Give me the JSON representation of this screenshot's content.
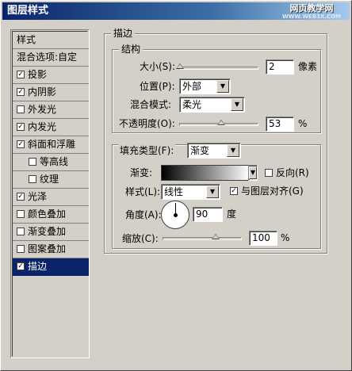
{
  "window": {
    "title": "图层样式",
    "watermark_line1": "网页教学网",
    "watermark_line2": "WWW.WEB3X.COM"
  },
  "left_list": {
    "header": "样式",
    "blend_options": "混合选项:自定",
    "items": [
      {
        "label": "投影",
        "checked": true,
        "indent": false
      },
      {
        "label": "内阴影",
        "checked": true,
        "indent": false
      },
      {
        "label": "外发光",
        "checked": false,
        "indent": false
      },
      {
        "label": "内发光",
        "checked": true,
        "indent": false
      },
      {
        "label": "斜面和浮雕",
        "checked": true,
        "indent": false
      },
      {
        "label": "等高线",
        "checked": false,
        "indent": true
      },
      {
        "label": "纹理",
        "checked": false,
        "indent": true
      },
      {
        "label": "光泽",
        "checked": true,
        "indent": false
      },
      {
        "label": "颜色叠加",
        "checked": false,
        "indent": false
      },
      {
        "label": "渐变叠加",
        "checked": false,
        "indent": false
      },
      {
        "label": "图案叠加",
        "checked": false,
        "indent": false
      },
      {
        "label": "描边",
        "checked": true,
        "indent": false,
        "selected": true
      }
    ]
  },
  "stroke": {
    "group_title": "描边",
    "structure_title": "结构",
    "size_label": "大小(S):",
    "size_value": "2",
    "size_unit": "像素",
    "size_level_percent": 2,
    "position_label": "位置(P):",
    "position_value": "外部",
    "blend_mode_label": "混合模式:",
    "blend_mode_value": "柔光",
    "opacity_label": "不透明度(O):",
    "opacity_value": "53",
    "opacity_unit": "%",
    "opacity_level_percent": 53
  },
  "fill": {
    "fill_type_label": "填充类型(F):",
    "fill_type_value": "渐变",
    "gradient_label": "渐变:",
    "reverse_label": "反向(R)",
    "reverse_checked": false,
    "style_label": "样式(L):",
    "style_value": "线性",
    "align_label": "与图层对齐(G)",
    "align_checked": true,
    "angle_label": "角度(A):",
    "angle_value": "90",
    "angle_unit": "度",
    "scale_label": "缩放(C):",
    "scale_value": "100",
    "scale_unit": "%",
    "scale_level_percent": 100
  },
  "colors": {
    "title_start": "#0a246a",
    "title_end": "#a6caf0",
    "selected_bg": "#0a246a",
    "face": "#d4d0c8"
  }
}
